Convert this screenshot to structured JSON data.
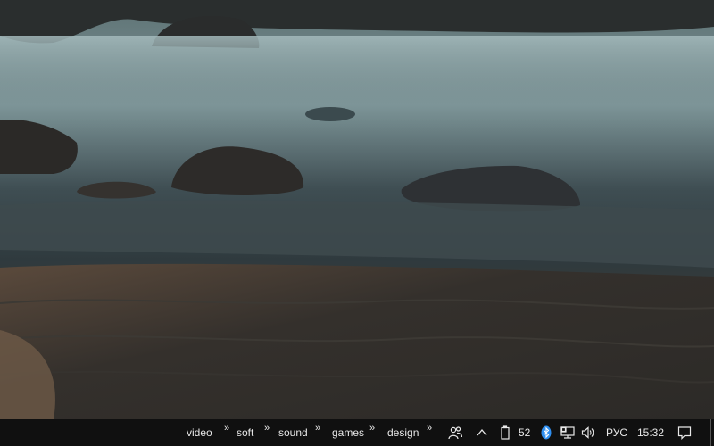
{
  "taskbar": {
    "toolbar_links": [
      {
        "label": "video"
      },
      {
        "label": "soft"
      },
      {
        "label": "sound"
      },
      {
        "label": "games"
      },
      {
        "label": "design"
      }
    ],
    "chevron_glyph": "»",
    "battery_percent": "52",
    "language": "РУС",
    "clock": "15:32"
  },
  "icons": {
    "people": "people-icon",
    "tray_expand": "chevron-up-icon",
    "battery": "battery-icon",
    "bluetooth": "bluetooth-icon",
    "network": "network-icon",
    "volume": "volume-icon",
    "notifications": "action-center-icon"
  },
  "colors": {
    "taskbar_bg": "#101010",
    "taskbar_text": "#e8e8e8",
    "bluetooth_accent": "#2f8ff0"
  }
}
